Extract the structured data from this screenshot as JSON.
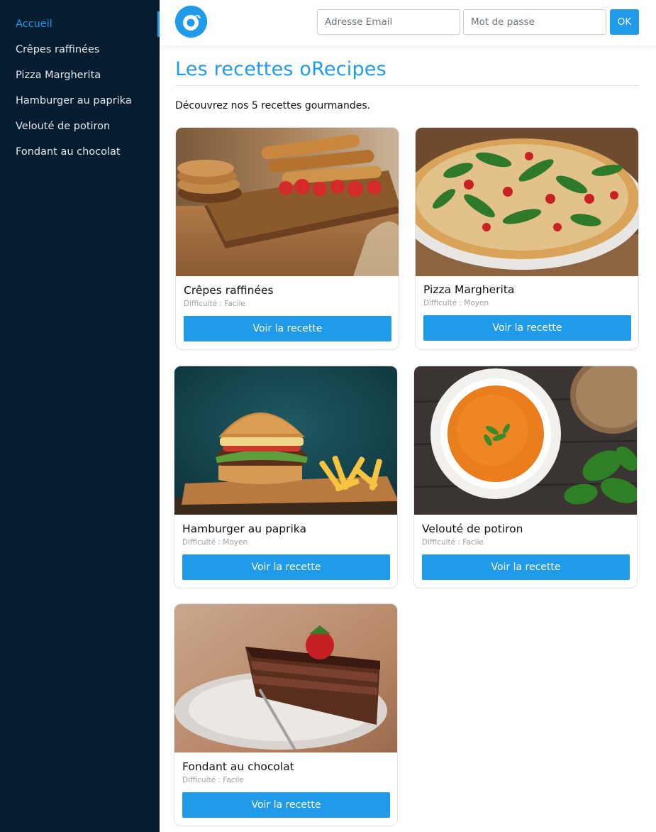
{
  "sidebar": {
    "items": [
      {
        "label": "Accueil",
        "active": true
      },
      {
        "label": "Crêpes raffinées"
      },
      {
        "label": "Pizza Margherita"
      },
      {
        "label": "Hamburger au paprika"
      },
      {
        "label": "Velouté de potiron"
      },
      {
        "label": "Fondant au chocolat"
      }
    ]
  },
  "header": {
    "logo_icon": "orecipes-logo-icon",
    "email_placeholder": "Adresse Email",
    "password_placeholder": "Mot de passe",
    "ok_label": "OK"
  },
  "main": {
    "title": "Les recettes oRecipes",
    "intro": "Découvrez nos 5 recettes gourmandes.",
    "recipes": [
      {
        "name": "Crêpes raffinées",
        "difficulty": "Difficulté : Facile",
        "button": "Voir la recette",
        "image_icon": "crepes-photo"
      },
      {
        "name": "Pizza Margherita",
        "difficulty": "Difficulté : Moyen",
        "button": "Voir la recette",
        "image_icon": "pizza-photo"
      },
      {
        "name": "Hamburger au paprika",
        "difficulty": "Difficulté : Moyen",
        "button": "Voir la recette",
        "image_icon": "burger-photo"
      },
      {
        "name": "Velouté de potiron",
        "difficulty": "Difficulté : Facile",
        "button": "Voir la recette",
        "image_icon": "soup-photo"
      },
      {
        "name": "Fondant au chocolat",
        "difficulty": "Difficulté : Facile",
        "button": "Voir la recette",
        "image_icon": "cake-photo"
      }
    ]
  },
  "colors": {
    "accent": "#1f9bea",
    "sidebar_bg": "#051d30"
  }
}
